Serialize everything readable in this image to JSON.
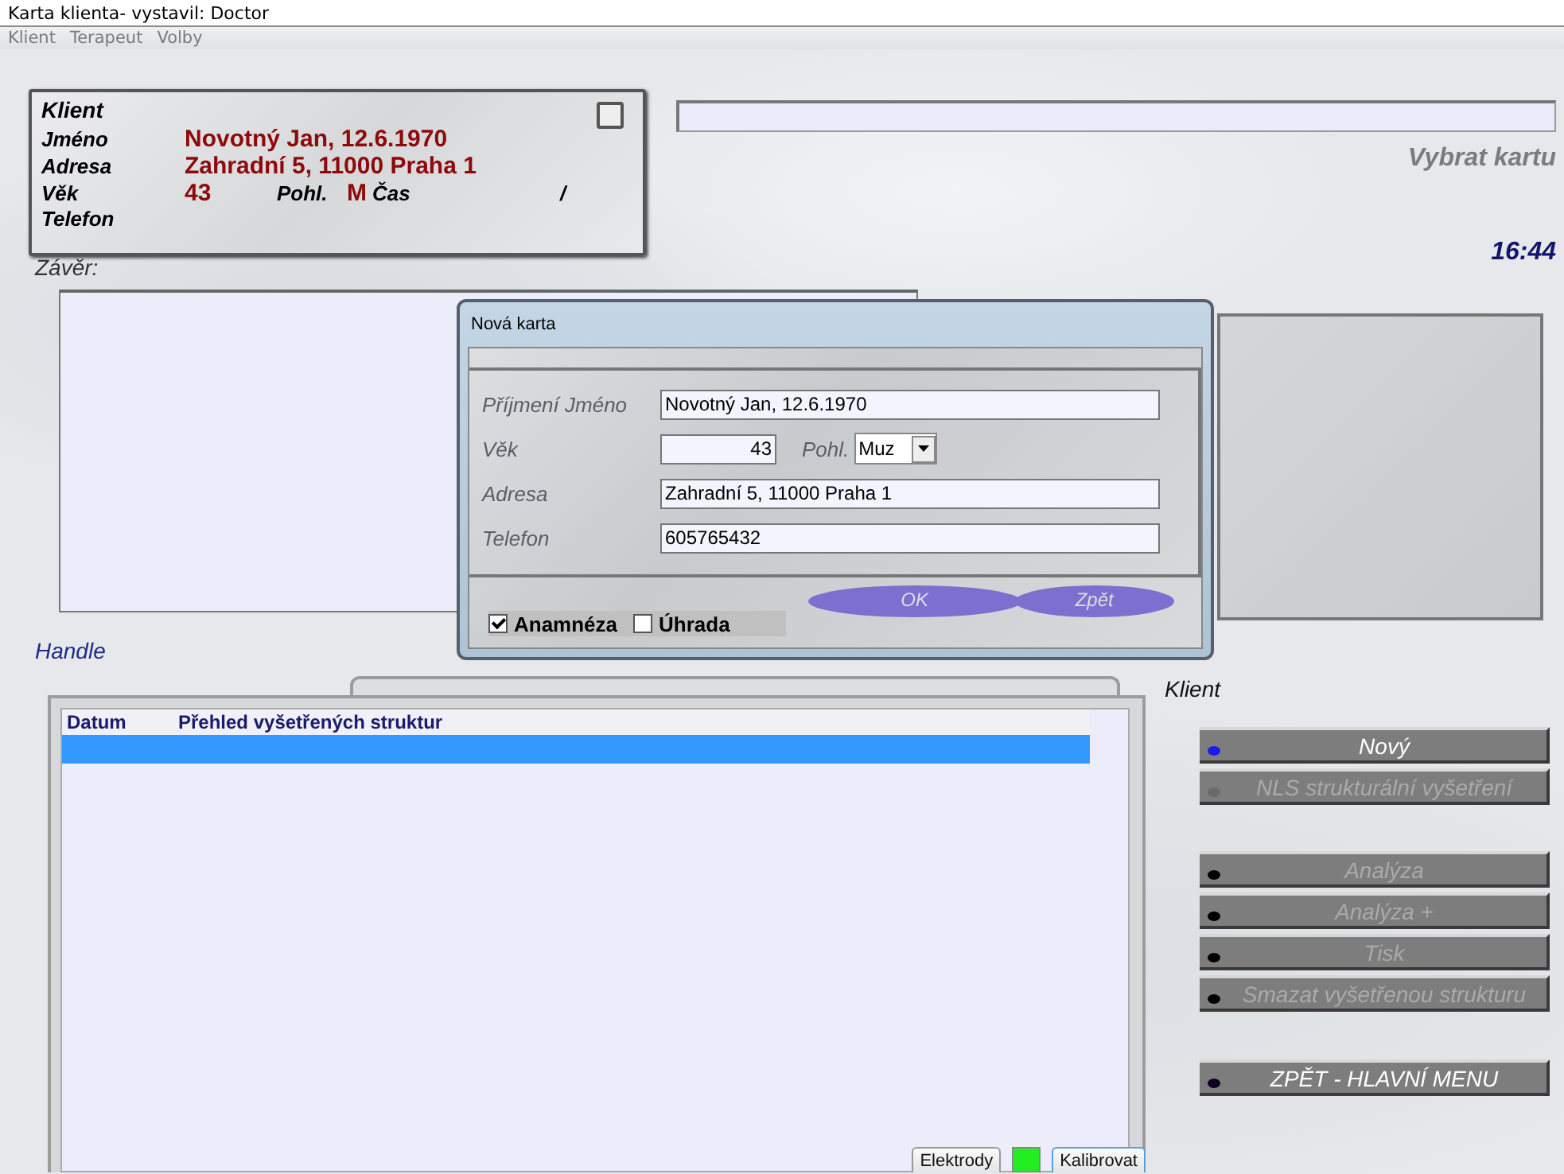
{
  "window": {
    "title": "Karta klienta- vystavil: Doctor"
  },
  "menu": [
    "Klient",
    "Terapeut",
    "Volby"
  ],
  "client_card": {
    "heading": "Klient",
    "checked": false,
    "name_label": "Jméno",
    "name": "Novotný Jan, 12.6.1970",
    "address_label": "Adresa",
    "address": "Zahradní 5, 11000 Praha 1",
    "age_label": "Věk",
    "age": "43",
    "sex_label": "Pohl.",
    "sex": "M",
    "time_label": "Čas",
    "time": "/",
    "phone_label": "Telefon"
  },
  "card_search": {
    "caption": "Vybrat kartu"
  },
  "clock": "16:44",
  "conclusion": {
    "label": "Závěr:"
  },
  "sessions": {
    "label": "Handle",
    "columns": [
      "Datum",
      "Přehled vyšetřených struktur"
    ],
    "rows": [
      {
        "selected": true
      }
    ]
  },
  "actions": {
    "label": "Klient",
    "groups": [
      [
        {
          "label": "Nový",
          "disabled": false,
          "color": "#1a1aee"
        },
        {
          "label": "NLS strukturální vyšetření",
          "disabled": true,
          "color": "#6a6a6a"
        }
      ],
      [
        {
          "label": "Analýza",
          "disabled": true,
          "color": "#000000"
        },
        {
          "label": "Analýza +",
          "disabled": true,
          "color": "#000000"
        },
        {
          "label": "Tisk",
          "disabled": true,
          "color": "#000000"
        },
        {
          "label": "Smazat vyšetřenou strukturu",
          "disabled": true,
          "color": "#000000"
        }
      ],
      [
        {
          "label": "ZPĚT - HLAVNÍ MENU",
          "disabled": false,
          "color": "#100020"
        }
      ]
    ]
  },
  "status": {
    "electrodes": "Elektrody",
    "indicator_on": true,
    "calibrate": "Kalibrovat"
  },
  "dialog": {
    "title": "Nová karta",
    "name_label": "Příjmení Jméno",
    "name": "Novotný Jan, 12.6.1970",
    "age_label": "Věk",
    "age": "43",
    "sex_label": "Pohl.",
    "sex": "Muz",
    "address_label": "Adresa",
    "address": "Zahradní 5, 11000 Praha 1",
    "phone_label": "Telefon",
    "phone": "605765432",
    "checks": [
      {
        "label": "Anamnéza",
        "checked": true
      },
      {
        "label": "Úhrada",
        "checked": false
      }
    ],
    "buttons": [
      "OK",
      "Zpět"
    ]
  }
}
